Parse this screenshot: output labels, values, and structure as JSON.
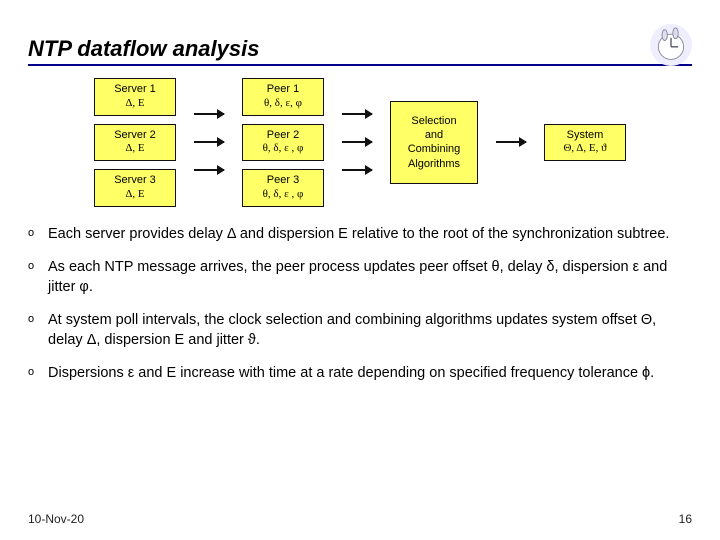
{
  "title": "NTP dataflow analysis",
  "diagram": {
    "servers": [
      {
        "l1": "Server 1",
        "l2": "Δ, Ε"
      },
      {
        "l1": "Server 2",
        "l2": "Δ, Ε"
      },
      {
        "l1": "Server 3",
        "l2": "Δ, Ε"
      }
    ],
    "peers": [
      {
        "l1": "Peer 1",
        "l2": "θ, δ, ε, φ"
      },
      {
        "l1": "Peer 2",
        "l2": "θ, δ, ε , φ"
      },
      {
        "l1": "Peer 3",
        "l2": "θ, δ, ε , φ"
      }
    ],
    "selection": "Selection\nand\nCombining\nAlgorithms",
    "system": {
      "l1": "System",
      "l2": "Θ, Δ, Ε, ϑ"
    }
  },
  "bullets": [
    "Each server provides delay Δ and dispersion Ε relative to the root of the synchronization subtree.",
    "As each NTP message arrives, the peer process updates peer offset θ, delay δ, dispersion ε and jitter φ.",
    "At system poll intervals, the clock selection and combining algorithms updates system offset Θ, delay Δ, dispersion Ε and jitter ϑ.",
    "Dispersions ε and Ε increase with time at a rate depending on specified frequency tolerance ϕ."
  ],
  "footer": {
    "date": "10-Nov-20",
    "page": "16"
  }
}
